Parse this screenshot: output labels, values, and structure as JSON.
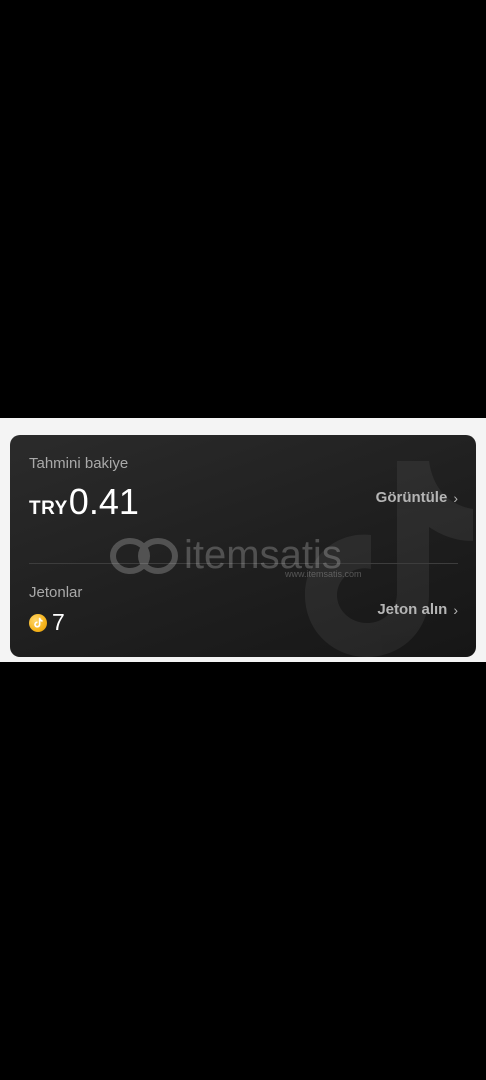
{
  "balance": {
    "label": "Tahmini bakiye",
    "currency": "TRY",
    "amount": "0.41",
    "view_link": "Görüntüle"
  },
  "coins": {
    "label": "Jetonlar",
    "value": "7",
    "get_link": "Jeton alın"
  },
  "watermark": {
    "text": "itemsatis",
    "subtext": "www.itemsatis.com"
  },
  "icons": {
    "coin": "coin-icon",
    "chevron": "chevron-right-icon",
    "background_logo": "tiktok-logo"
  },
  "colors": {
    "page_background": "#000000",
    "band_background": "#f4f4f4",
    "card_background": "#1f1f1f",
    "primary_text": "#ffffff",
    "secondary_text": "#a9a9a9",
    "coin_gold": "#f5b31b"
  }
}
